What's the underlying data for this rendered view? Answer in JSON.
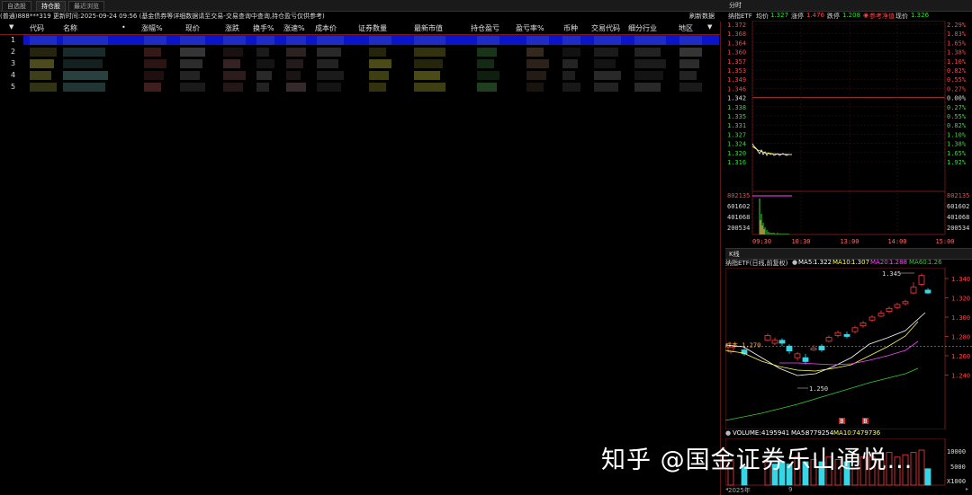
{
  "tabs": [
    {
      "label": "自选股",
      "active": false
    },
    {
      "label": "持仓股",
      "active": true
    },
    {
      "label": "最近浏览",
      "active": false
    }
  ],
  "info_line": "(普通)888***319 更新时间:2025-09-24 09:56 (基金债券等详细数据请至交易-交易查询中查询,持仓盈亏仅供参考)",
  "refresh_label": "刷新数据",
  "table": {
    "sort_arrow": "▼",
    "headers": [
      "代码",
      "名称",
      "•",
      "涨幅%",
      "现价",
      "涨跌",
      "换手%",
      "涨速%",
      "成本价",
      "证券数量",
      "最新市值",
      "持仓盈亏",
      "盈亏率%",
      "币种",
      "交易代码",
      "细分行业",
      "地区",
      "▼"
    ],
    "rows": [
      "1",
      "2",
      "3",
      "4",
      "5"
    ]
  },
  "intraday": {
    "title": "分时",
    "name": "纳指ETF",
    "avg_label": "均价",
    "avg": "1.327",
    "limit_up_label": "涨停",
    "limit_up": "1.476",
    "limit_down_label": "跌停",
    "limit_down": "1.208",
    "ref_label": "参考净值",
    "price_label": "现价",
    "price": "1.326",
    "price_ticks": [
      "1.372",
      "1.368",
      "1.364",
      "1.360",
      "1.357",
      "1.353",
      "1.349",
      "1.346",
      "1.342",
      "1.338",
      "1.335",
      "1.331",
      "1.327",
      "1.324",
      "1.320",
      "1.316"
    ],
    "pct_ticks": [
      "2.29%",
      "1.83%",
      "1.65%",
      "1.38%",
      "1.10%",
      "0.82%",
      "0.55%",
      "0.27%",
      "0.00%",
      "0.27%",
      "0.55%",
      "0.82%",
      "1.10%",
      "1.38%",
      "1.65%",
      "1.92%"
    ],
    "vol_ticks": [
      "802135",
      "601602",
      "401068",
      "200534"
    ],
    "time_ticks": [
      "09:30",
      "10:30",
      "13:00",
      "14:00",
      "15:00"
    ]
  },
  "kline": {
    "title": "K线",
    "name": "纳指ETF(日线,前复权)",
    "ma5_label": "MA5:",
    "ma5": "1.322",
    "ma10_label": "MA10:",
    "ma10": "1.307",
    "ma20_label": "MA20:",
    "ma20": "1.288",
    "ma60_label": "MA60:",
    "ma60": "1.26",
    "price_ticks": [
      "1.340",
      "1.320",
      "1.300",
      "1.280",
      "1.260",
      "1.240"
    ],
    "high_label": "1.345",
    "low_label": "1.250",
    "cost_label": "成本 1.270",
    "marker": "B",
    "volume_label": "VOLUME:",
    "volume": "4195941",
    "vma5_label": "MA5:",
    "vma5": "8779254",
    "vma10_label": "MA10:",
    "vma10": "7479736",
    "vol_ticks": [
      "10000",
      "5000"
    ],
    "vol_unit": "X1000",
    "date_labels": [
      "2025年",
      "9"
    ]
  },
  "watermark": "知乎 @国金证券乐山通悦...",
  "colors": {
    "up": "#ff3b3b",
    "down": "#37d6e6",
    "accent": "#0c14c8",
    "ma5": "#ffffff",
    "ma10": "#ffff55",
    "ma20": "#ff44ff",
    "ma60": "#33cc33"
  }
}
